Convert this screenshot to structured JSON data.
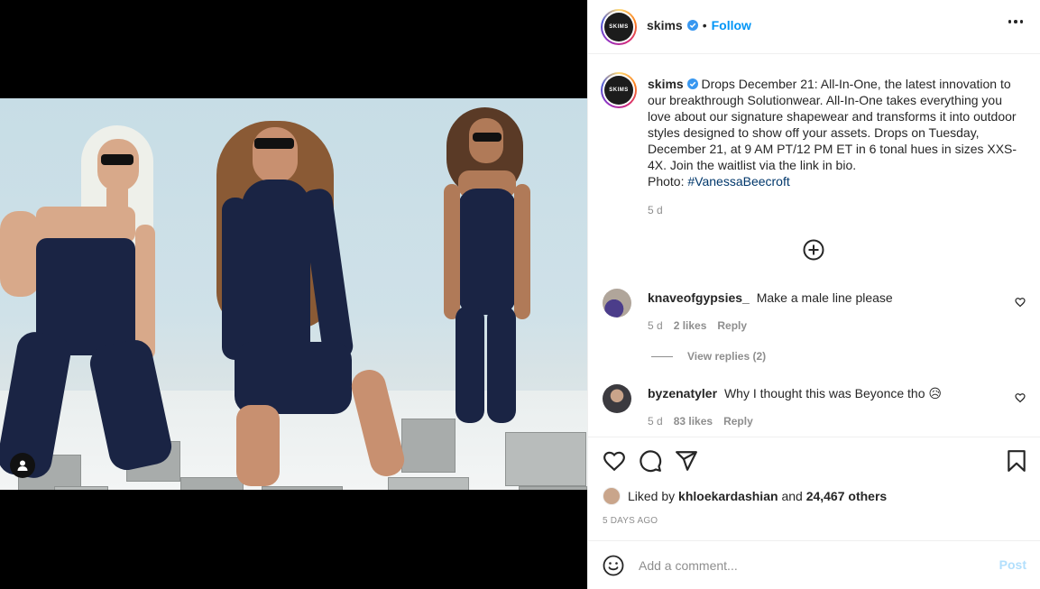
{
  "post": {
    "username": "skims",
    "follow_label": "Follow",
    "separator": "•",
    "avatar_text": "SKIMS",
    "caption": "Drops December 21: All-In-One, the latest innovation to our breakthrough Solutionwear. All-In-One takes everything you love about our signature shapewear and transforms it into outdoor styles designed to show off your assets. Drops on Tuesday, December 21, at 9 AM PT/12 PM ET in 6 tonal hues in sizes XXS-4X. Join the waitlist via the link in bio.",
    "photo_credit_prefix": "Photo: ",
    "photo_credit_tag": "#VanessaBeecroft",
    "caption_age": "5 d"
  },
  "comments": [
    {
      "username": "knaveofgypsies_",
      "text": "Make a male line please",
      "age": "5 d",
      "likes": "2 likes",
      "reply_label": "Reply"
    },
    {
      "username": "byzenatyler",
      "text": "Why I thought this was Beyonce tho 😥",
      "age": "5 d",
      "likes": "83 likes",
      "reply_label": "Reply"
    }
  ],
  "view_replies_label": "View replies (2)",
  "likes": {
    "prefix": "Liked by ",
    "user": "khloekardashian",
    "middle": " and ",
    "others": "24,467 others"
  },
  "post_date": "5 DAYS AGO",
  "add_comment": {
    "placeholder": "Add a comment...",
    "post_label": "Post"
  },
  "colors": {
    "follow": "#0095f6",
    "post_disabled": "#b2dffc",
    "hashtag": "#00376b",
    "secondary_text": "#8e8e8e"
  }
}
